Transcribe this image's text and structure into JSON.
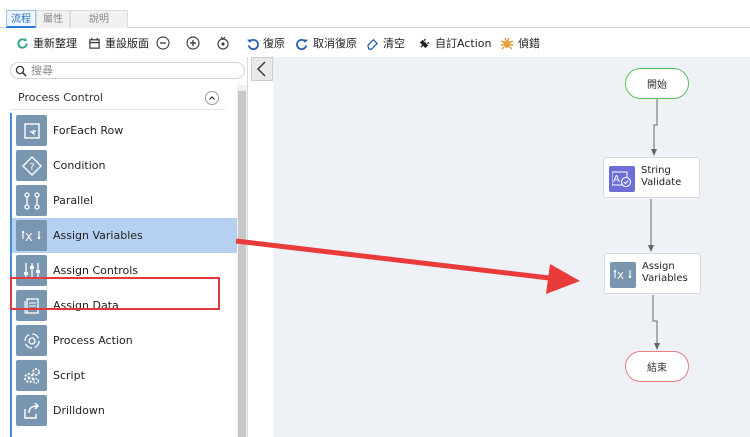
{
  "tabs": [
    {
      "label": "流程",
      "active": true
    },
    {
      "label": "屬性",
      "active": false
    },
    {
      "label": "說明",
      "active": false
    }
  ],
  "toolbar": {
    "relayout": "重新整理",
    "reset_layout": "重設版面",
    "undo": "復原",
    "redo": "取消復原",
    "clear": "清空",
    "custom_action": "自訂Action",
    "debug": "偵錯"
  },
  "search": {
    "placeholder": "搜尋"
  },
  "palette": {
    "group_title": "Process Control",
    "items": [
      {
        "label": "ForEach Row",
        "icon": "foreach-icon"
      },
      {
        "label": "Condition",
        "icon": "condition-icon"
      },
      {
        "label": "Parallel",
        "icon": "parallel-icon"
      },
      {
        "label": "Assign Variables",
        "icon": "assign-variables-icon",
        "selected": true
      },
      {
        "label": "Assign Controls",
        "icon": "assign-controls-icon"
      },
      {
        "label": "Assign Data",
        "icon": "assign-data-icon"
      },
      {
        "label": "Process Action",
        "icon": "process-action-icon"
      },
      {
        "label": "Script",
        "icon": "script-icon"
      },
      {
        "label": "Drilldown",
        "icon": "drilldown-icon"
      }
    ]
  },
  "flow": {
    "start": "開始",
    "string_validate_1": "String",
    "string_validate_2": "Validate",
    "assign_variables_1": "Assign",
    "assign_variables_2": "Variables",
    "end": "結束"
  },
  "colors": {
    "accent": "#2b7bd3",
    "selection": "#b5d0f0",
    "highlight_red": "#e23a3a",
    "start_border": "#5cc05a",
    "end_border": "#e47f7f",
    "icon_bg": "#7996b1"
  }
}
